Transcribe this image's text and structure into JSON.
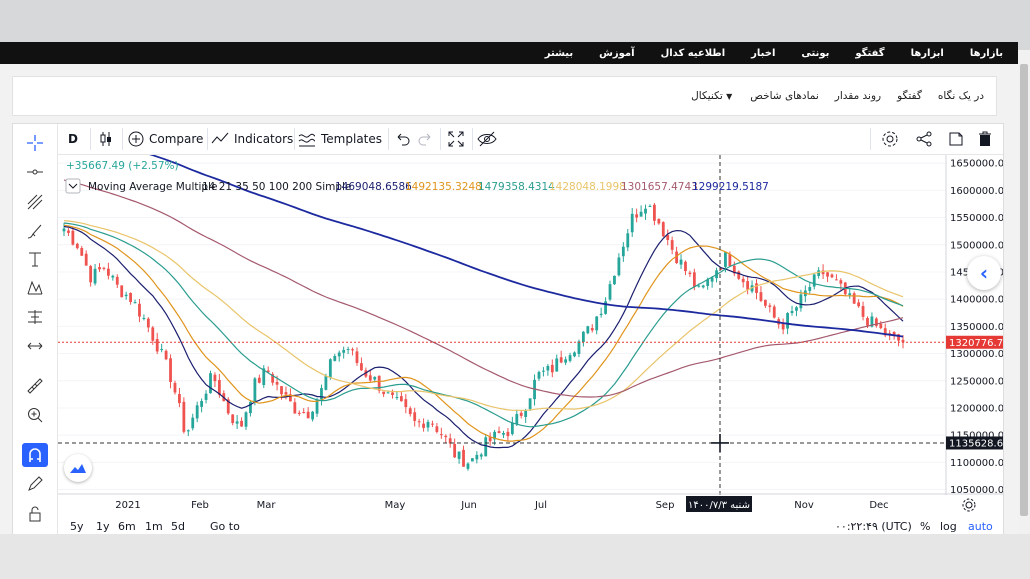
{
  "navbar": {
    "items": [
      "بازارها",
      "ابزارها",
      "گفتگو",
      "بونتی",
      "اخبار",
      "اطلاعیه کدال",
      "آموزش",
      "بیشتر"
    ]
  },
  "submenu": {
    "items": [
      "در یک نگاه",
      "گفتگو",
      "روند مقدار",
      "نمادهای شاخص",
      "تکنیکال"
    ]
  },
  "toolbar": {
    "interval": "D",
    "compare_label": "Compare",
    "indicators_label": "Indicators",
    "templates_label": "Templates"
  },
  "chart": {
    "change_text": "+35667.49 (+2.57%)",
    "legend_title": "Moving Average Multiple",
    "legend_params": "14 21 35 50 100 200 Simple",
    "ma_values": [
      "1469048.6586",
      "1492135.3248",
      "1479358.4314",
      "1428048.1998",
      "1301657.4743",
      "1299219.5187"
    ],
    "price_label": "1320776.73",
    "crosshair_label": "1135628.67",
    "crosshair_date": "شنبه ۱۴۰۰/۷/۳",
    "colors": {
      "ma": [
        "#1b1f6e",
        "#e0941c",
        "#2a9d8f",
        "#e9c46a",
        "#a55a6e",
        "#1d2a9f"
      ],
      "up": "#26a69a",
      "down": "#ef5350",
      "price_line": "#e53935",
      "accent": "#2962ff"
    }
  },
  "chart_data": {
    "type": "candlestick",
    "y_ticks": [
      "1650000.00",
      "1600000.00",
      "1550000.00",
      "1500000.00",
      "1450000.00",
      "1400000.00",
      "1350000.00",
      "1300000.00",
      "1250000.00",
      "1200000.00",
      "1150000.00",
      "1100000.00",
      "1050000.00"
    ],
    "ylim": [
      1040000,
      1665000
    ],
    "x_ticks": [
      "2021",
      "Feb",
      "Mar",
      "May",
      "Jun",
      "Jul",
      "Sep",
      "Nov",
      "Dec"
    ],
    "close_series": [
      1530000,
      1500000,
      1440000,
      1460000,
      1420000,
      1400000,
      1360000,
      1310000,
      1250000,
      1150000,
      1210000,
      1260000,
      1200000,
      1160000,
      1240000,
      1270000,
      1230000,
      1200000,
      1190000,
      1230000,
      1300000,
      1310000,
      1270000,
      1250000,
      1220000,
      1200000,
      1170000,
      1180000,
      1150000,
      1110000,
      1100000,
      1130000,
      1150000,
      1160000,
      1200000,
      1260000,
      1270000,
      1300000,
      1320000,
      1350000,
      1400000,
      1480000,
      1550000,
      1580000,
      1540000,
      1490000,
      1450000,
      1410000,
      1450000,
      1480000,
      1440000,
      1420000,
      1380000,
      1350000,
      1380000,
      1420000,
      1450000,
      1430000,
      1400000,
      1370000,
      1350000,
      1330000,
      1320776.73
    ],
    "series": [
      {
        "name": "MA14",
        "last": 1469048.6586
      },
      {
        "name": "MA21",
        "last": 1492135.3248
      },
      {
        "name": "MA35",
        "last": 1479358.4314
      },
      {
        "name": "MA50",
        "last": 1428048.1998
      },
      {
        "name": "MA100",
        "last": 1301657.4743
      },
      {
        "name": "MA200",
        "last": 1299219.5187
      }
    ],
    "price_line": 1320776.73,
    "crosshair_y": 1135628.67
  },
  "bottombar": {
    "ranges": [
      "5y",
      "1y",
      "6m",
      "1m",
      "5d"
    ],
    "goto_label": "Go to",
    "timezone": "۰۰:۲۲:۴۹ (UTC)",
    "percent_label": "%",
    "log_label": "log",
    "auto_label": "auto"
  }
}
